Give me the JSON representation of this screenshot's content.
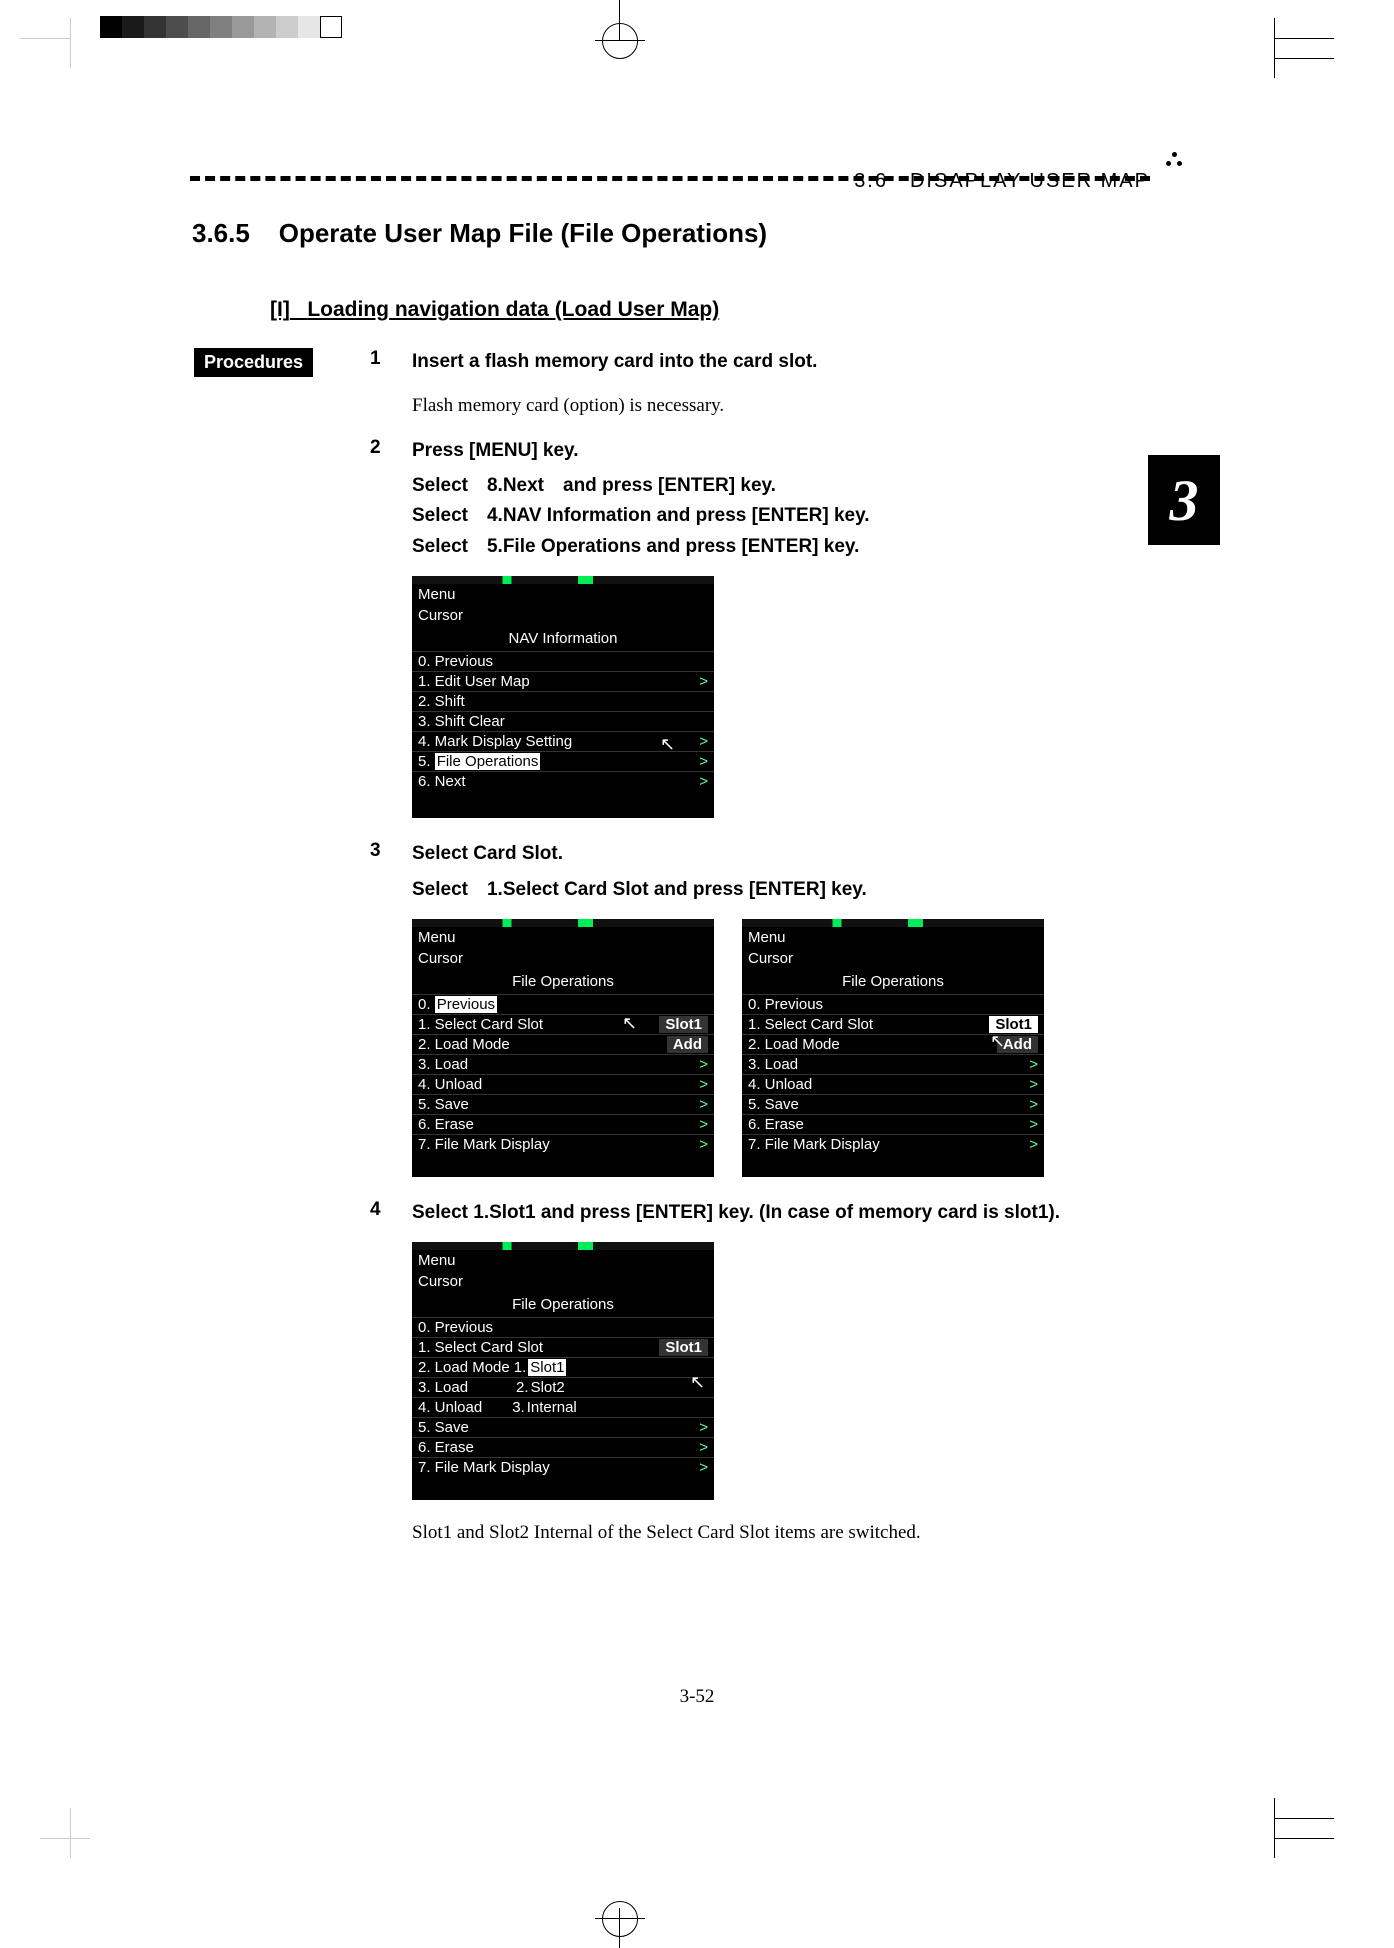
{
  "header": {
    "section_ref": "3.6　DISAPLAY USER MAP"
  },
  "section": {
    "number": "3.6.5",
    "title": "Operate User Map File (File Operations)",
    "sub_label": "[I]",
    "sub_title": "Loading navigation data (Load User Map)"
  },
  "procedures_label": "Procedures",
  "chapter_tab": "3",
  "steps": {
    "s1": {
      "num": "1",
      "title": "Insert a flash memory card into the card slot.",
      "note": "Flash memory card (option) is necessary."
    },
    "s2": {
      "num": "2",
      "title": "Press [MENU] key.",
      "line1": "Select　8.Next　and press [ENTER] key.",
      "line2": "Select　4.NAV Information and press [ENTER] key.",
      "line3": "Select　5.File Operations and press [ENTER] key."
    },
    "s3": {
      "num": "3",
      "title": "Select Card Slot.",
      "line1": "Select　1.Select Card Slot and press [ENTER] key."
    },
    "s4": {
      "num": "4",
      "title": "Select 1.Slot1 and press [ENTER] key. (In case of memory card is slot1)."
    }
  },
  "shot1": {
    "menu": "Menu",
    "cursor": "Cursor",
    "title": "NAV Information",
    "r0": "0. Previous",
    "r1": "1. Edit User Map",
    "r2": "2. Shift",
    "r3": "3. Shift Clear",
    "r4": "4. Mark Display Setting",
    "r5": "5. File Operations",
    "r6": "6. Next"
  },
  "shot2": {
    "menu": "Menu",
    "cursor": "Cursor",
    "title": "File Operations",
    "r0": "0. Previous",
    "r1": "1. Select Card Slot",
    "r1v": "Slot1",
    "r2": "2. Load Mode",
    "r2v": "Add",
    "r3": "3. Load",
    "r4": "4. Unload",
    "r5": "5. Save",
    "r6": "6. Erase",
    "r7": "7. File Mark Display"
  },
  "shot3": {
    "menu": "Menu",
    "cursor": "Cursor",
    "title": "File Operations",
    "r0": "0. Previous",
    "r1": "1. Select Card Slot",
    "r1v": "Slot1",
    "r2": "2. Load Mode",
    "r2v": "Add",
    "r3": "3. Load",
    "r4": "4. Unload",
    "r5": "5. Save",
    "r6": "6. Erase",
    "r7": "7. File Mark Display"
  },
  "shot4": {
    "menu": "Menu",
    "cursor": "Cursor",
    "title": "File Operations",
    "r0": "0. Previous",
    "r1": "1. Select Card Slot",
    "r1v": "Slot1",
    "r2": "2. Load Mode",
    "sub1n": "1.",
    "sub1": "Slot1",
    "r3": "3. Load",
    "sub2n": "2.",
    "sub2": "Slot2",
    "r4": "4. Unload",
    "sub3n": "3.",
    "sub3": "Internal",
    "r5": "5. Save",
    "r6": "6. Erase",
    "r7": "7. File Mark Display"
  },
  "switch_note": "Slot1 and Slot2 Internal of the Select Card Slot items are switched.",
  "page_number": "3-52",
  "swatch_colors": [
    "#000",
    "#1a1a1a",
    "#333",
    "#4d4d4d",
    "#666",
    "#808080",
    "#999",
    "#b3b3b3",
    "#ccc",
    "#e6e6e6",
    "#fff"
  ]
}
